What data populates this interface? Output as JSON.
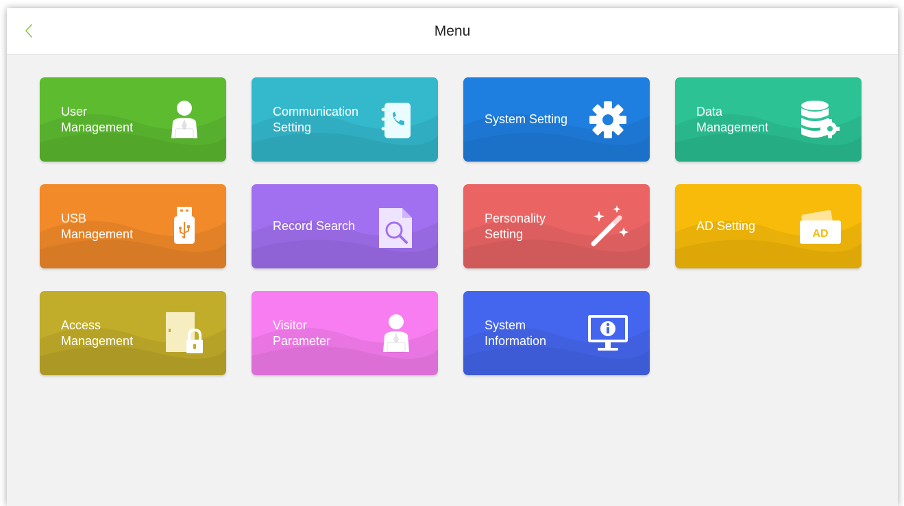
{
  "header": {
    "title": "Menu",
    "back_icon": "chevron-left-icon",
    "back_color": "#8dc63f"
  },
  "tiles": [
    {
      "id": "user-management",
      "label_lines": [
        "User",
        "Management"
      ],
      "icon": "user-icon",
      "color": "#5dbb30"
    },
    {
      "id": "communication-setting",
      "label_lines": [
        "Communication",
        "Setting"
      ],
      "icon": "phonebook-icon",
      "color": "#33b8cc"
    },
    {
      "id": "system-setting",
      "label_lines": [
        "System Setting"
      ],
      "icon": "gear-icon",
      "color": "#1f7fe0"
    },
    {
      "id": "data-management",
      "label_lines": [
        "Data",
        "Management"
      ],
      "icon": "database-gear-icon",
      "color": "#2cc294"
    },
    {
      "id": "usb-management",
      "label_lines": [
        "USB",
        "Management"
      ],
      "icon": "usb-drive-icon",
      "color": "#f28a2a"
    },
    {
      "id": "record-search",
      "label_lines": [
        "Record Search"
      ],
      "icon": "document-search-icon",
      "color": "#a170f0"
    },
    {
      "id": "personality-setting",
      "label_lines": [
        "Personality",
        "Setting"
      ],
      "icon": "magic-wand-icon",
      "color": "#ea6464"
    },
    {
      "id": "ad-setting",
      "label_lines": [
        "AD Setting"
      ],
      "icon": "ad-card-icon",
      "color": "#f8bb0a"
    },
    {
      "id": "access-management",
      "label_lines": [
        "Access",
        "Management"
      ],
      "icon": "door-lock-icon",
      "color": "#c2ad2a"
    },
    {
      "id": "visitor-parameter",
      "label_lines": [
        "Visitor",
        "Parameter"
      ],
      "icon": "visitor-icon",
      "color": "#f77df0"
    },
    {
      "id": "system-information",
      "label_lines": [
        "System",
        "Information"
      ],
      "icon": "monitor-info-icon",
      "color": "#4466ee"
    }
  ]
}
